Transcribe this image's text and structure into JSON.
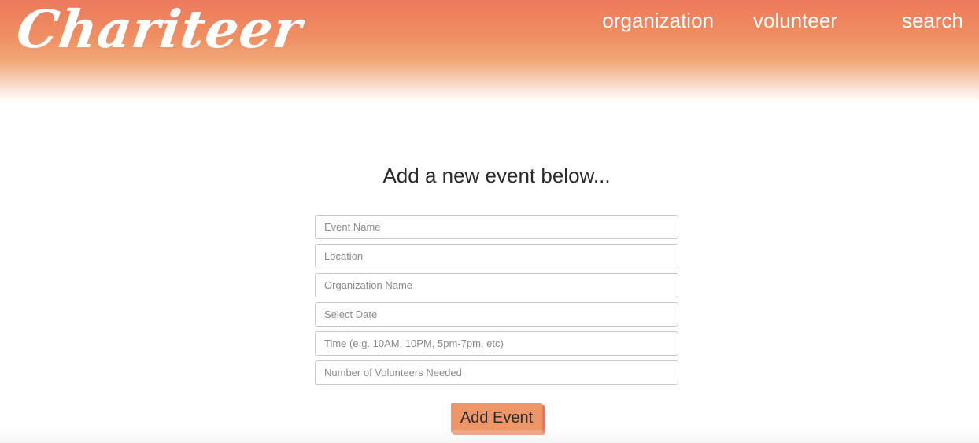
{
  "header": {
    "logo_text": "Chariteer",
    "nav": [
      {
        "label": "organization"
      },
      {
        "label": "volunteer"
      },
      {
        "label": "search"
      }
    ]
  },
  "main": {
    "heading": "Add a new event below...",
    "fields": [
      {
        "placeholder": "Event Name",
        "value": ""
      },
      {
        "placeholder": "Location",
        "value": ""
      },
      {
        "placeholder": "Organization Name",
        "value": ""
      },
      {
        "placeholder": "Select Date",
        "value": ""
      },
      {
        "placeholder": "Time (e.g. 10AM, 10PM, 5pm-7pm, etc)",
        "value": ""
      },
      {
        "placeholder": "Number of Volunteers Needed",
        "value": ""
      }
    ],
    "submit_label": "Add Event"
  },
  "colors": {
    "header_gradient_top": "#ec7a5c",
    "button_fill": "#ee9668",
    "button_shadow": "#f2714f"
  }
}
